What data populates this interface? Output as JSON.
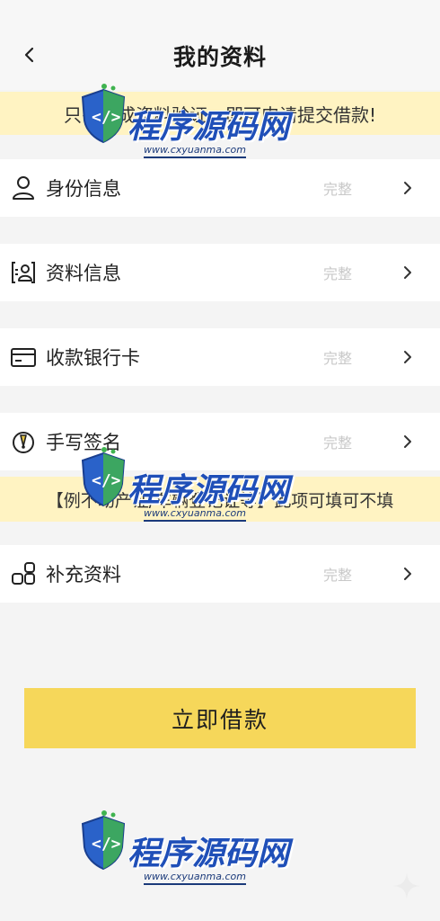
{
  "header": {
    "title": "我的资料"
  },
  "notice_top": "只需完成资料验证，即可申请提交借款!",
  "items": [
    {
      "icon": "person-icon",
      "label": "身份信息",
      "status": "完整"
    },
    {
      "icon": "id-card-icon",
      "label": "资料信息",
      "status": "完整"
    },
    {
      "icon": "bank-card-icon",
      "label": "收款银行卡",
      "status": "完整"
    },
    {
      "icon": "signature-icon",
      "label": "手写签名",
      "status": "完整"
    },
    {
      "icon": "grid-blocks-icon",
      "label": "补充资料",
      "status": "完整"
    }
  ],
  "notice_mid": "【例不动产证/车辆登记证等】此项可填可不填",
  "submit_label": "立即借款",
  "watermark": {
    "brand": "程序源码网",
    "url": "www.cxyuanma.com"
  },
  "colors": {
    "accent": "#f6d75a",
    "notice_bg": "#fff3c2",
    "page_bg": "#f4f4f4",
    "status_text": "#c8c8c8",
    "watermark_blue": "#1f4fb8"
  }
}
